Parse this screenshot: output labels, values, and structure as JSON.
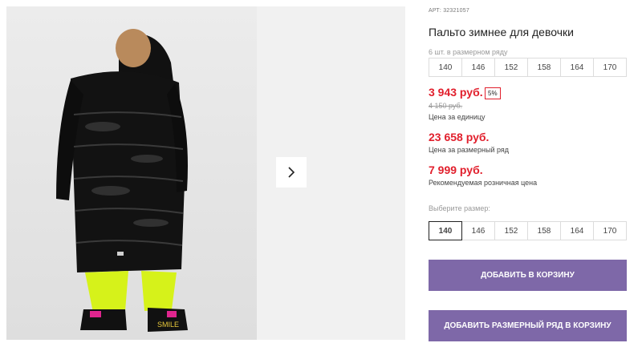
{
  "product": {
    "article": "АРТ: 32321057",
    "title": "Пальто зимнее для девочки",
    "row_note": "6 шт. в размерном ряду",
    "row_sizes": [
      "140",
      "146",
      "152",
      "158",
      "164",
      "170"
    ]
  },
  "prices": {
    "unit_price": "3 943 руб.",
    "discount_badge": "5%",
    "old_price": "4 150 руб.",
    "unit_note": "Цена за единицу",
    "row_price": "23 658 руб.",
    "row_note": "Цена за размерный ряд",
    "retail_price": "7 999 руб.",
    "retail_note": "Рекомендуемая розничная цена"
  },
  "size_picker": {
    "label": "Выберите размер:",
    "sizes": [
      "140",
      "146",
      "152",
      "158",
      "164",
      "170"
    ],
    "selected": "140"
  },
  "actions": {
    "add_to_cart": "Добавить в корзину",
    "add_row_to_cart": "Добавить размерный ряд в корзину"
  },
  "colors": {
    "price_red": "#e11f2c",
    "button_purple": "#7e68a8"
  },
  "icons": {
    "gallery_next": "chevron-right-icon"
  }
}
